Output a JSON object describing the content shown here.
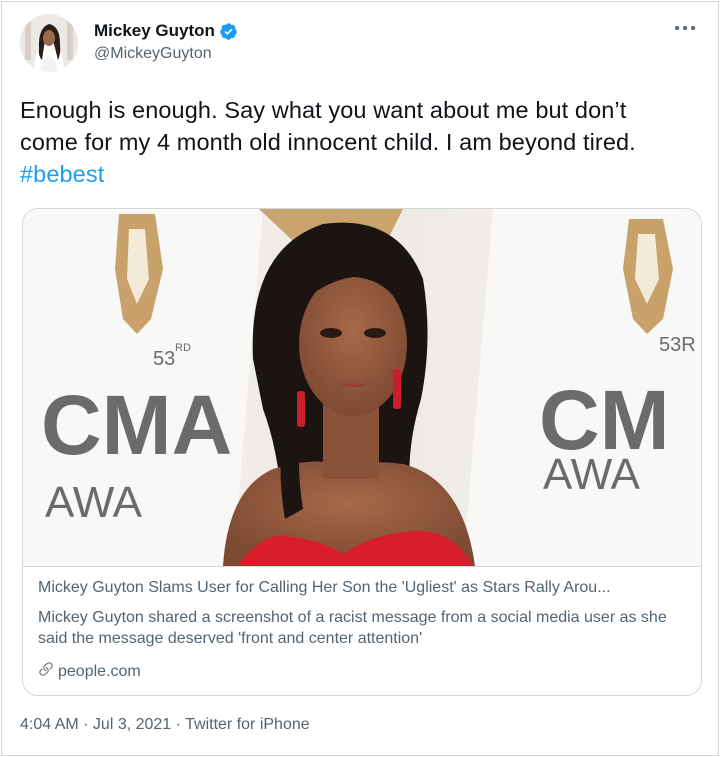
{
  "author": {
    "name": "Mickey Guyton",
    "handle": "@MickeyGuyton"
  },
  "icons": {
    "verified": "verified-badge-icon",
    "more": "more-dots-icon",
    "link": "link-icon"
  },
  "tweet": {
    "text": "Enough is enough. Say what you want about me but don’t come for my 4 month old innocent child. I am beyond tired. ",
    "hashtag": "#bebest"
  },
  "card": {
    "title": "Mickey Guyton Slams User for Calling Her Son the 'Ugliest' as Stars Rally Arou...",
    "description": "Mickey Guyton shared a screenshot of a racist message from a social media user as she said the message deserved 'front and center attention'",
    "domain": "people.com",
    "backdrop": {
      "number": "53",
      "suffix": "RD",
      "number_right": "53R",
      "word1_left": "CMA",
      "word2_left": "AWA",
      "word1_right": "CM",
      "word2_right": "AWA"
    }
  },
  "meta": {
    "time": "4:04 AM",
    "sep1": " · ",
    "date": "Jul 3, 2021",
    "sep2": " · ",
    "source": "Twitter for iPhone"
  },
  "colors": {
    "accent": "#1d9bf0",
    "text": "#0f1419",
    "secondary": "#536471",
    "border": "#cfd9de",
    "dress": "#d81e2c",
    "gold": "#c8a26a",
    "backdrop_text": "#6b6b6b"
  }
}
